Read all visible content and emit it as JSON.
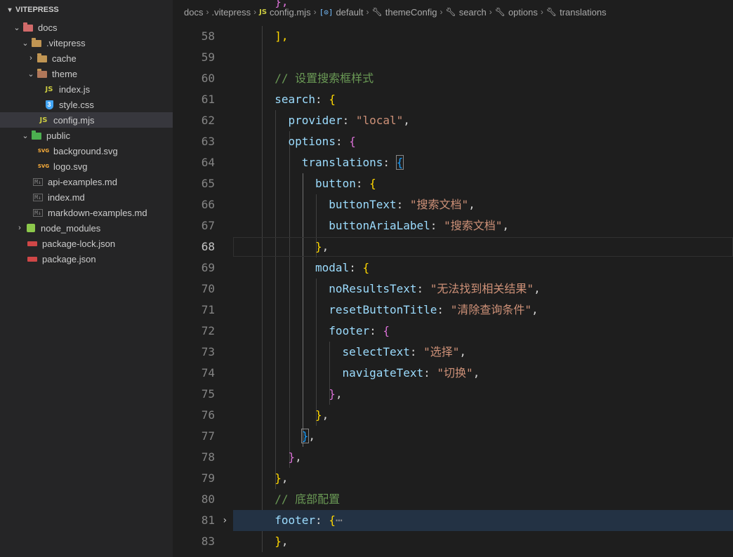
{
  "explorer": {
    "root_label": "VITEPRESS",
    "items": [
      {
        "label": "docs"
      },
      {
        "label": ".vitepress"
      },
      {
        "label": "cache"
      },
      {
        "label": "theme"
      },
      {
        "label": "index.js"
      },
      {
        "label": "style.css"
      },
      {
        "label": "config.mjs"
      },
      {
        "label": "public"
      },
      {
        "label": "background.svg"
      },
      {
        "label": "logo.svg"
      },
      {
        "label": "api-examples.md"
      },
      {
        "label": "index.md"
      },
      {
        "label": "markdown-examples.md"
      },
      {
        "label": "node_modules"
      },
      {
        "label": "package-lock.json"
      },
      {
        "label": "package.json"
      }
    ]
  },
  "breadcrumb": {
    "items": [
      "docs",
      ".vitepress",
      "config.mjs",
      "default",
      "themeConfig",
      "search",
      "options",
      "translations"
    ]
  },
  "editor": {
    "lines": [
      {
        "n": "58",
        "tokens": [
          "],"
        ]
      },
      {
        "n": "59",
        "tokens": []
      },
      {
        "n": "60",
        "tokens": [
          "// 设置搜索框样式"
        ]
      },
      {
        "n": "61",
        "tokens": [
          "search",
          ": ",
          "{"
        ]
      },
      {
        "n": "62",
        "tokens": [
          "provider",
          ": ",
          "\"local\"",
          ","
        ]
      },
      {
        "n": "63",
        "tokens": [
          "options",
          ": ",
          "{"
        ]
      },
      {
        "n": "64",
        "tokens": [
          "translations",
          ": ",
          "{"
        ]
      },
      {
        "n": "65",
        "tokens": [
          "button",
          ": ",
          "{"
        ]
      },
      {
        "n": "66",
        "tokens": [
          "buttonText",
          ": ",
          "\"搜索文档\"",
          ","
        ]
      },
      {
        "n": "67",
        "tokens": [
          "buttonAriaLabel",
          ": ",
          "\"搜索文档\"",
          ","
        ]
      },
      {
        "n": "68",
        "tokens": [
          "}",
          ","
        ]
      },
      {
        "n": "69",
        "tokens": [
          "modal",
          ": ",
          "{"
        ]
      },
      {
        "n": "70",
        "tokens": [
          "noResultsText",
          ": ",
          "\"无法找到相关结果\"",
          ","
        ]
      },
      {
        "n": "71",
        "tokens": [
          "resetButtonTitle",
          ": ",
          "\"清除查询条件\"",
          ","
        ]
      },
      {
        "n": "72",
        "tokens": [
          "footer",
          ": ",
          "{"
        ]
      },
      {
        "n": "73",
        "tokens": [
          "selectText",
          ": ",
          "\"选择\"",
          ","
        ]
      },
      {
        "n": "74",
        "tokens": [
          "navigateText",
          ": ",
          "\"切换\"",
          ","
        ]
      },
      {
        "n": "75",
        "tokens": [
          "}",
          ","
        ]
      },
      {
        "n": "76",
        "tokens": [
          "}",
          ","
        ]
      },
      {
        "n": "77",
        "tokens": [
          "}",
          ","
        ]
      },
      {
        "n": "78",
        "tokens": [
          "}",
          ","
        ]
      },
      {
        "n": "79",
        "tokens": [
          "}",
          ","
        ]
      },
      {
        "n": "80",
        "tokens": [
          "// 底部配置"
        ]
      },
      {
        "n": "81",
        "tokens": [
          "footer",
          ": ",
          "{",
          "⋯"
        ]
      },
      {
        "n": "83",
        "tokens": [
          "}",
          ","
        ]
      }
    ],
    "active_line": "68",
    "folded_line": "81",
    "partial_top": "},"
  },
  "colors": {
    "background": "#1e1e1e",
    "sidebar": "#252526",
    "selection": "#37373d",
    "property": "#9cdcfe",
    "string": "#ce9178",
    "comment": "#6a9955",
    "bracket_gold": "#ffd700",
    "bracket_orchid": "#da70d6",
    "bracket_blue": "#179fff"
  }
}
